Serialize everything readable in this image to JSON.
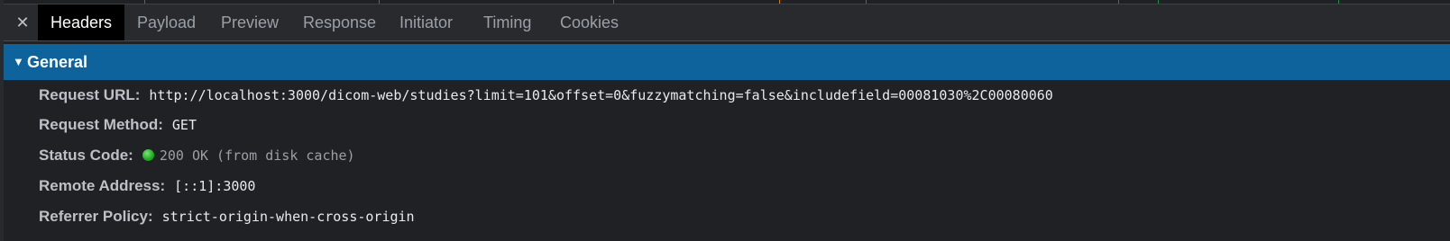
{
  "tabs": [
    {
      "label": "Headers",
      "active": true
    },
    {
      "label": "Payload",
      "active": false
    },
    {
      "label": "Preview",
      "active": false
    },
    {
      "label": "Response",
      "active": false
    },
    {
      "label": "Initiator",
      "active": false
    },
    {
      "label": "Timing",
      "active": false
    },
    {
      "label": "Cookies",
      "active": false
    }
  ],
  "close_glyph": "✕",
  "general": {
    "title": "General",
    "toggle_glyph": "▼",
    "request_url": {
      "key": "Request URL:",
      "value": "http://localhost:3000/dicom-web/studies?limit=101&offset=0&fuzzymatching=false&includefield=00081030%2C00080060"
    },
    "request_method": {
      "key": "Request Method:",
      "value": "GET"
    },
    "status_code": {
      "key": "Status Code:",
      "value": "200 OK (from disk cache)",
      "status_color": "#22b022"
    },
    "remote_address": {
      "key": "Remote Address:",
      "value": "[::1]:3000"
    },
    "referrer_policy": {
      "key": "Referrer Policy:",
      "value": "strict-origin-when-cross-origin"
    }
  },
  "colors": {
    "accent": "#0e639c",
    "background": "#202124",
    "tabbar": "#292a2d"
  }
}
